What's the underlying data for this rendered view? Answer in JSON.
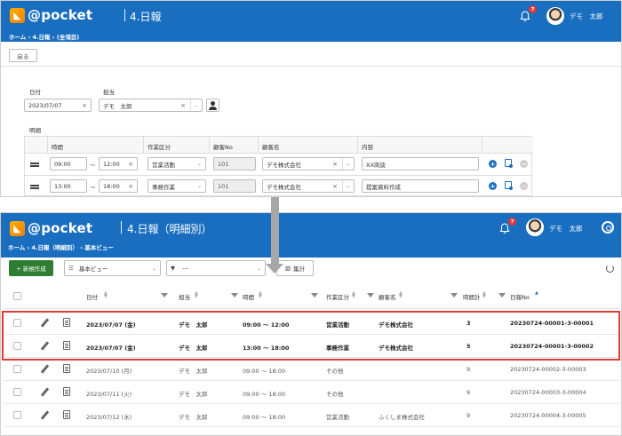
{
  "top": {
    "brand": "@pocket",
    "page_title": "4.日報",
    "breadcrumb": [
      "ホーム",
      "4.日報",
      "(全項目)"
    ],
    "notifications": "7",
    "user": "デモ　太郎",
    "back_label": "戻る",
    "form": {
      "date_label": "日付",
      "date_value": "2023/07/07",
      "owner_label": "担当",
      "owner_value": "デモ　太郎",
      "detail_label": "明細"
    },
    "detail_headers": [
      "時間",
      "作業区分",
      "顧客No",
      "顧客名",
      "内容"
    ],
    "detail_rows": [
      {
        "start": "09:00",
        "tilde": "〜",
        "end": "12:00",
        "work": "営業活動",
        "cust_no": "101",
        "cust_name": "デモ株式会社",
        "content": "XX商談"
      },
      {
        "start": "13:00",
        "tilde": "〜",
        "end": "18:00",
        "work": "事務作業",
        "cust_no": "101",
        "cust_name": "デモ株式会社",
        "content": "提案資料作成"
      }
    ]
  },
  "bottom": {
    "brand": "@pocket",
    "page_title": "4.日報（明細別）",
    "breadcrumb": [
      "ホーム",
      "4.日報（明細別）",
      "基本ビュー"
    ],
    "notifications": "7",
    "user": "デモ　太郎",
    "new_label": "+ 新規作成",
    "view_select": "基本ビュー",
    "filter_select": "---",
    "agg_label": "集計",
    "columns": [
      "日付",
      "担当",
      "時間",
      "作業区分",
      "顧客名",
      "時間計",
      "日報No"
    ],
    "rows": [
      {
        "date": "2023/07/07 (金)",
        "owner": "デモ　太郎",
        "time": "09:00 ～ 12:00",
        "work": "営業活動",
        "cust": "デモ株式会社",
        "hours": "3",
        "no": "20230724-00001-3-00001"
      },
      {
        "date": "2023/07/07 (金)",
        "owner": "デモ　太郎",
        "time": "13:00 ～ 18:00",
        "work": "事務作業",
        "cust": "デモ株式会社",
        "hours": "5",
        "no": "20230724-00001-3-00002"
      },
      {
        "date": "2023/07/10 (月)",
        "owner": "デモ　太郎",
        "time": "09:00 ～ 18:00",
        "work": "その他",
        "cust": "",
        "hours": "9",
        "no": "20230724-00002-3-00003"
      },
      {
        "date": "2023/07/11 (火)",
        "owner": "デモ　太郎",
        "time": "09:00 ～ 18:00",
        "work": "その他",
        "cust": "",
        "hours": "9",
        "no": "20230724-00003-3-00004"
      },
      {
        "date": "2023/07/12 (水)",
        "owner": "デモ　太郎",
        "time": "09:00 ～ 18:00",
        "work": "営業活動",
        "cust": "ふくしま株式会社",
        "hours": "9",
        "no": "20230724-00004-3-00005"
      }
    ]
  },
  "colors": {
    "header_blue": "#1a6ec0",
    "highlight_red": "#e53935",
    "new_green": "#2e7d32"
  }
}
